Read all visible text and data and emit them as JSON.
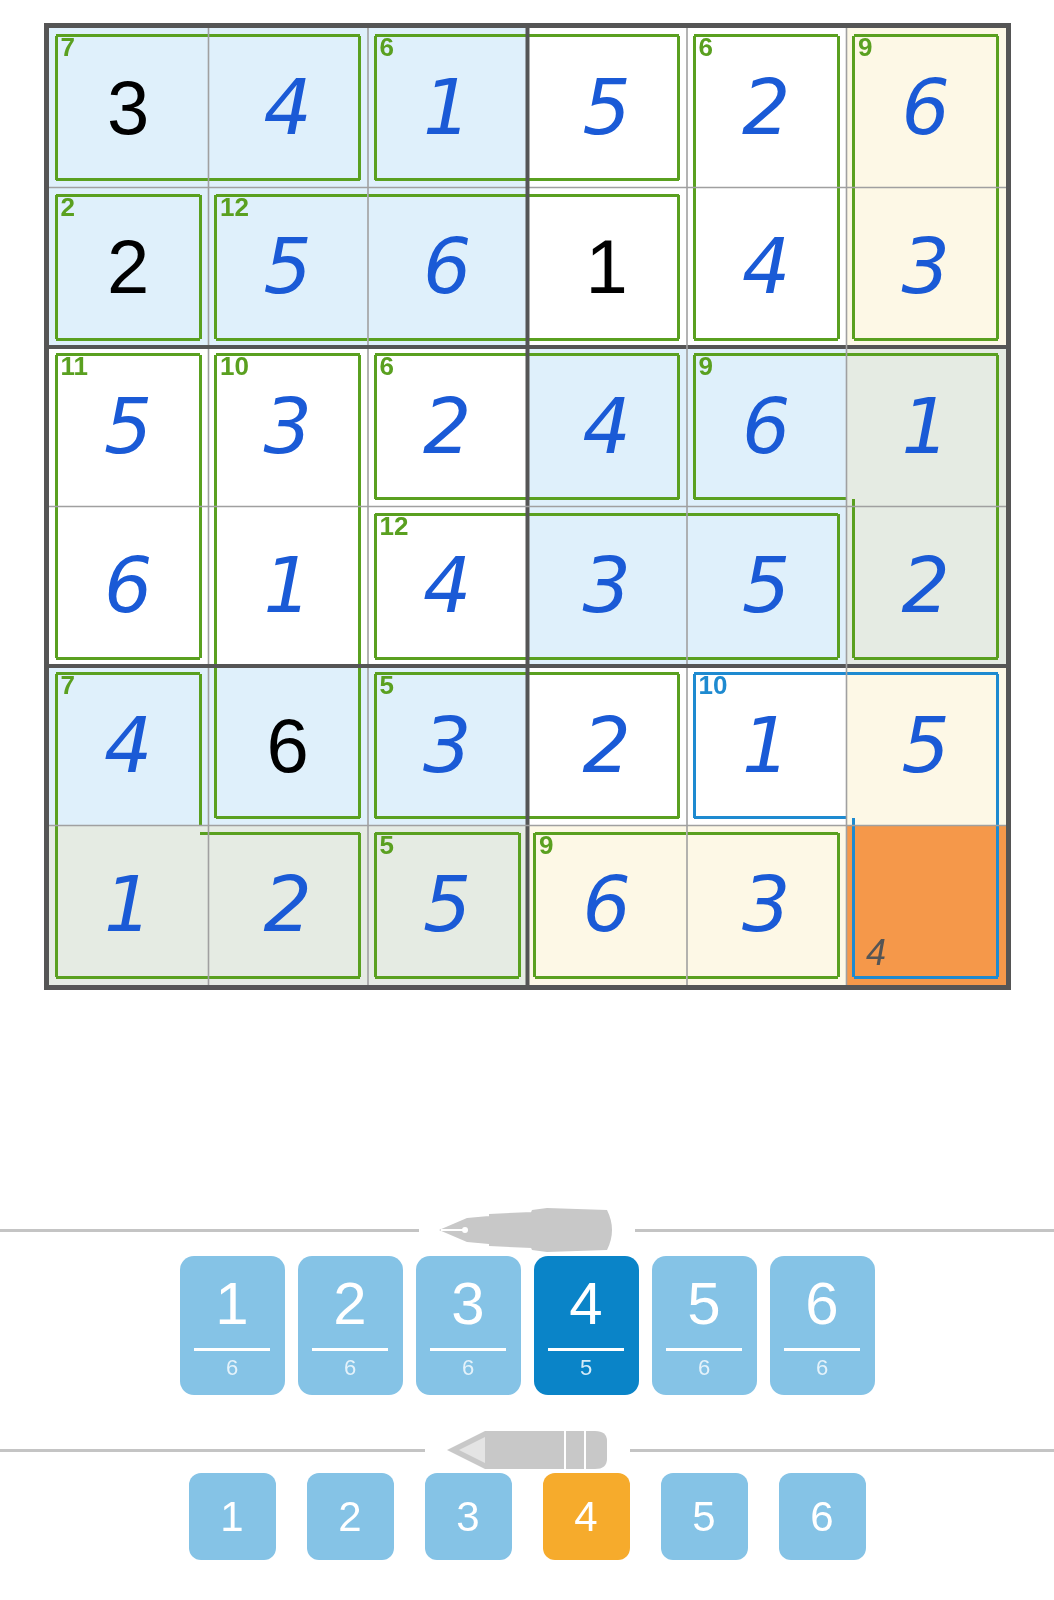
{
  "grid": [
    [
      {
        "value": "3",
        "kind": "given",
        "cage": {
          "sum": "7",
          "color": "#5aa020"
        },
        "walls": {
          "top": true,
          "bottom": true,
          "left": true
        },
        "color": "#dff0fb",
        "selected": false
      },
      {
        "value": "4",
        "kind": "entered",
        "walls": {
          "top": true,
          "right": true,
          "bottom": true
        },
        "color": "#dff0fb",
        "selected": false
      },
      {
        "value": "1",
        "kind": "entered",
        "cage": {
          "sum": "6",
          "color": "#5aa020"
        },
        "walls": {
          "top": true,
          "bottom": true,
          "left": true
        },
        "color": "#dff0fb",
        "selected": false
      },
      {
        "value": "5",
        "kind": "entered",
        "walls": {
          "top": true,
          "right": true,
          "bottom": true
        },
        "color": "#ffffff",
        "selected": false
      },
      {
        "value": "2",
        "kind": "entered",
        "cage": {
          "sum": "6",
          "color": "#5aa020"
        },
        "walls": {
          "top": true,
          "right": true,
          "left": true
        },
        "color": "#ffffff",
        "selected": false
      },
      {
        "value": "6",
        "kind": "entered",
        "cage": {
          "sum": "9",
          "color": "#5aa020"
        },
        "walls": {
          "top": true,
          "right": true,
          "left": true
        },
        "color": "#fdf8e6",
        "selected": false
      }
    ],
    [
      {
        "value": "2",
        "kind": "given",
        "cage": {
          "sum": "2",
          "color": "#5aa020"
        },
        "walls": {
          "top": true,
          "right": true,
          "bottom": true,
          "left": true
        },
        "color": "#dff0fb",
        "selected": false
      },
      {
        "value": "5",
        "kind": "entered",
        "cage": {
          "sum": "12",
          "color": "#5aa020"
        },
        "walls": {
          "top": true,
          "bottom": true,
          "left": true
        },
        "color": "#dff0fb",
        "selected": false
      },
      {
        "value": "6",
        "kind": "entered",
        "walls": {
          "top": true,
          "bottom": true
        },
        "color": "#dff0fb",
        "selected": false
      },
      {
        "value": "1",
        "kind": "given",
        "walls": {
          "top": true,
          "right": true,
          "bottom": true
        },
        "color": "#ffffff",
        "selected": false
      },
      {
        "value": "4",
        "kind": "entered",
        "walls": {
          "right": true,
          "bottom": true,
          "left": true
        },
        "color": "#ffffff",
        "selected": false
      },
      {
        "value": "3",
        "kind": "entered",
        "walls": {
          "right": true,
          "bottom": true,
          "left": true
        },
        "color": "#fdf8e6",
        "selected": false
      }
    ],
    [
      {
        "value": "5",
        "kind": "entered",
        "cage": {
          "sum": "11",
          "color": "#5aa020"
        },
        "walls": {
          "top": true,
          "right": true,
          "left": true
        },
        "color": "#ffffff",
        "selected": false
      },
      {
        "value": "3",
        "kind": "entered",
        "cage": {
          "sum": "10",
          "color": "#5aa020"
        },
        "walls": {
          "top": true,
          "right": true,
          "left": true
        },
        "color": "#ffffff",
        "selected": false
      },
      {
        "value": "2",
        "kind": "entered",
        "cage": {
          "sum": "6",
          "color": "#5aa020"
        },
        "walls": {
          "top": true,
          "bottom": true,
          "left": true
        },
        "color": "#ffffff",
        "selected": false
      },
      {
        "value": "4",
        "kind": "entered",
        "walls": {
          "top": true,
          "right": true,
          "bottom": true
        },
        "color": "#dff0fb",
        "selected": false
      },
      {
        "value": "6",
        "kind": "entered",
        "cage": {
          "sum": "9",
          "color": "#5aa020"
        },
        "walls": {
          "top": true,
          "bottom": true,
          "left": true
        },
        "color": "#dff0fb",
        "selected": false
      },
      {
        "value": "1",
        "kind": "entered",
        "walls": {
          "top": true,
          "right": true
        },
        "color": "#e5ebe3",
        "selected": false
      }
    ],
    [
      {
        "value": "6",
        "kind": "entered",
        "walls": {
          "right": true,
          "bottom": true,
          "left": true
        },
        "color": "#ffffff",
        "selected": false
      },
      {
        "value": "1",
        "kind": "entered",
        "walls": {
          "right": true,
          "left": true
        },
        "color": "#ffffff",
        "selected": false
      },
      {
        "value": "4",
        "kind": "entered",
        "cage": {
          "sum": "12",
          "color": "#5aa020"
        },
        "walls": {
          "top": true,
          "bottom": true,
          "left": true
        },
        "color": "#ffffff",
        "selected": false
      },
      {
        "value": "3",
        "kind": "entered",
        "walls": {
          "top": true,
          "bottom": true
        },
        "color": "#dff0fb",
        "selected": false
      },
      {
        "value": "5",
        "kind": "entered",
        "walls": {
          "top": true,
          "right": true,
          "bottom": true
        },
        "color": "#dff0fb",
        "selected": false
      },
      {
        "value": "2",
        "kind": "entered",
        "walls": {
          "right": true,
          "bottom": true,
          "left": true
        },
        "color": "#e5ebe3",
        "selected": false
      }
    ],
    [
      {
        "value": "4",
        "kind": "entered",
        "cage": {
          "sum": "7",
          "color": "#5aa020"
        },
        "walls": {
          "top": true,
          "right": true,
          "left": true
        },
        "color": "#dff0fb",
        "selected": false
      },
      {
        "value": "6",
        "kind": "given",
        "walls": {
          "right": true,
          "bottom": true,
          "left": true
        },
        "color": "#dff0fb",
        "selected": false
      },
      {
        "value": "3",
        "kind": "entered",
        "cage": {
          "sum": "5",
          "color": "#5aa020"
        },
        "walls": {
          "top": true,
          "bottom": true,
          "left": true
        },
        "color": "#dff0fb",
        "selected": false
      },
      {
        "value": "2",
        "kind": "entered",
        "walls": {
          "top": true,
          "right": true,
          "bottom": true
        },
        "color": "#ffffff",
        "selected": false
      },
      {
        "value": "1",
        "kind": "entered",
        "cage": {
          "sum": "10",
          "color": "#1e8ad0"
        },
        "walls": {
          "top": true,
          "bottom": true,
          "left": true
        },
        "color": "#ffffff",
        "selected": false
      },
      {
        "value": "5",
        "kind": "entered",
        "walls": {
          "top": true,
          "right": true
        },
        "color": "#fdf8e6",
        "selected": false
      }
    ],
    [
      {
        "value": "1",
        "kind": "entered",
        "walls": {
          "bottom": true,
          "left": true
        },
        "color": "#e5ebe3",
        "selected": false
      },
      {
        "value": "2",
        "kind": "entered",
        "walls": {
          "top": true,
          "right": true,
          "bottom": true
        },
        "color": "#e5ebe3",
        "selected": false
      },
      {
        "value": "5",
        "kind": "entered",
        "cage": {
          "sum": "5",
          "color": "#5aa020"
        },
        "walls": {
          "top": true,
          "right": true,
          "bottom": true,
          "left": true
        },
        "color": "#e5ebe3",
        "selected": false
      },
      {
        "value": "6",
        "kind": "entered",
        "cage": {
          "sum": "9",
          "color": "#5aa020"
        },
        "walls": {
          "top": true,
          "bottom": true,
          "left": true
        },
        "color": "#fdf8e6",
        "selected": false
      },
      {
        "value": "3",
        "kind": "entered",
        "walls": {
          "top": true,
          "right": true,
          "bottom": true
        },
        "color": "#fdf8e6",
        "selected": false
      },
      {
        "pencil": [
          "4"
        ],
        "walls": {
          "right": true,
          "bottom": true,
          "left": true
        },
        "selected": true
      }
    ]
  ],
  "pen_numbers": [
    {
      "digit": "1",
      "remaining": "6",
      "selected": false
    },
    {
      "digit": "2",
      "remaining": "6",
      "selected": false
    },
    {
      "digit": "3",
      "remaining": "6",
      "selected": false
    },
    {
      "digit": "4",
      "remaining": "5",
      "selected": true
    },
    {
      "digit": "5",
      "remaining": "6",
      "selected": false
    },
    {
      "digit": "6",
      "remaining": "6",
      "selected": false
    }
  ],
  "pencil_numbers": [
    {
      "digit": "1",
      "selected": false
    },
    {
      "digit": "2",
      "selected": false
    },
    {
      "digit": "3",
      "selected": false
    },
    {
      "digit": "4",
      "selected": true
    },
    {
      "digit": "5",
      "selected": false
    },
    {
      "digit": "6",
      "selected": false
    }
  ]
}
